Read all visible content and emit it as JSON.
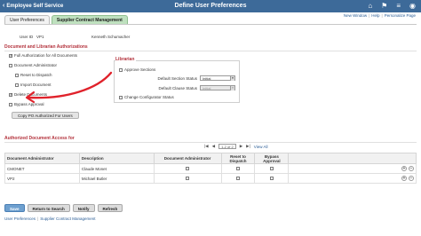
{
  "header": {
    "back_label": "Employee Self Service",
    "title": "Define User Preferences",
    "icons": [
      "home-icon",
      "flag-icon",
      "menu-icon",
      "more-icon"
    ],
    "links": [
      "New Window",
      "Help",
      "Personalize Page"
    ]
  },
  "tabs": [
    {
      "label": "User Preferences",
      "active": false
    },
    {
      "label": "Supplier Contract Management",
      "active": true
    }
  ],
  "user": {
    "label": "User ID",
    "id": "VP1",
    "name": "Kenneth Schumacher"
  },
  "authorizations": {
    "heading": "Document and Librarian Authorizations",
    "full_auth": {
      "label": "Full Authorization for All Documents",
      "checked": true
    },
    "doc_admin": {
      "label": "Document Administrator",
      "checked": false
    },
    "reset_dispatch": {
      "label": "Reset to Dispatch",
      "checked": false
    },
    "import_doc": {
      "label": "Import Document",
      "checked": false
    },
    "delete_docs": {
      "label": "Delete Documents",
      "checked": true
    },
    "bypass": {
      "label": "Bypass Approval",
      "checked": false
    },
    "copy_button": "Copy PO Authorized For Users"
  },
  "librarian": {
    "title": "Librarian",
    "approve": {
      "label": "Approve Sections",
      "checked": false
    },
    "default_section_status_label": "Default Section Status",
    "default_section_status": "Initial",
    "default_clause_status_label": "Default Clause Status",
    "default_clause_status": "Initial",
    "change_config": {
      "label": "Change Configurator Status",
      "checked": false
    }
  },
  "grid": {
    "heading": "Authorized Document Access for",
    "pager": "1-2 of 2",
    "view_all": "View All",
    "columns": [
      "Document Administrator",
      "Description",
      "Document Administrator",
      "Reset to Dispatch",
      "Bypass Approval"
    ],
    "rows": [
      {
        "admin": "CMONET",
        "description": "Claude Monet"
      },
      {
        "admin": "VP2",
        "description": "Michael Butler"
      }
    ]
  },
  "buttons": {
    "save": "Save",
    "return": "Return to Search",
    "notify": "Notify",
    "refresh": "Refresh"
  },
  "footer": {
    "link1": "User Preferences",
    "link2": "Supplier Contract Management"
  },
  "colors": {
    "header_bg": "#3d6a99",
    "section_heading": "#b3313b",
    "active_tab": "#bfe1bf",
    "annotation_arrow": "#e0222b"
  }
}
